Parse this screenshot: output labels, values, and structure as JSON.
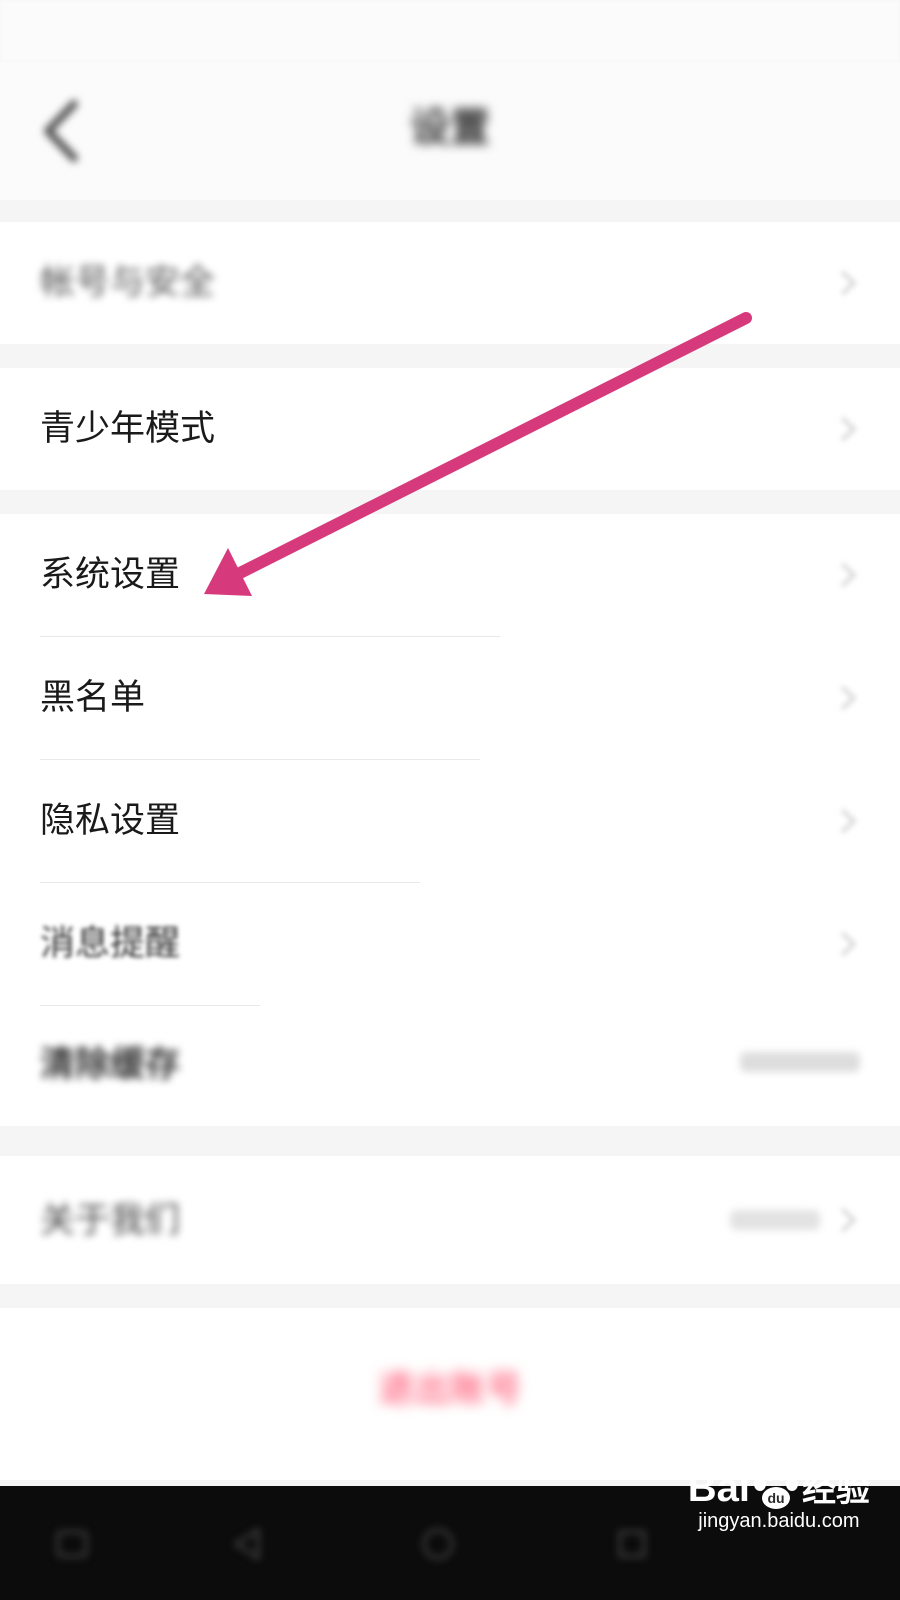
{
  "header": {
    "title": "设置"
  },
  "sections": {
    "account": {
      "label": "帐号与安全"
    },
    "teen": {
      "label": "青少年模式"
    },
    "system": {
      "label": "系统设置"
    },
    "blacklist": {
      "label": "黑名单"
    },
    "privacy": {
      "label": "隐私设置"
    },
    "notify": {
      "label": "消息提醒"
    },
    "cache": {
      "label": "清除缓存"
    },
    "about": {
      "label": "关于我们"
    }
  },
  "logout": {
    "label": "退出账号"
  },
  "watermark": {
    "logo_text": "Bai",
    "logo_text2": "经验",
    "url": "jingyan.baidu.com"
  },
  "colors": {
    "arrow": "#d63a7c",
    "logout": "#ff3b5c",
    "background": "#f5f5f5"
  },
  "icons": {
    "back": "chevron-left-icon",
    "row_arrow": "chevron-right-icon",
    "watermark_paw": "paw-icon",
    "annotation": "arrow-icon"
  }
}
